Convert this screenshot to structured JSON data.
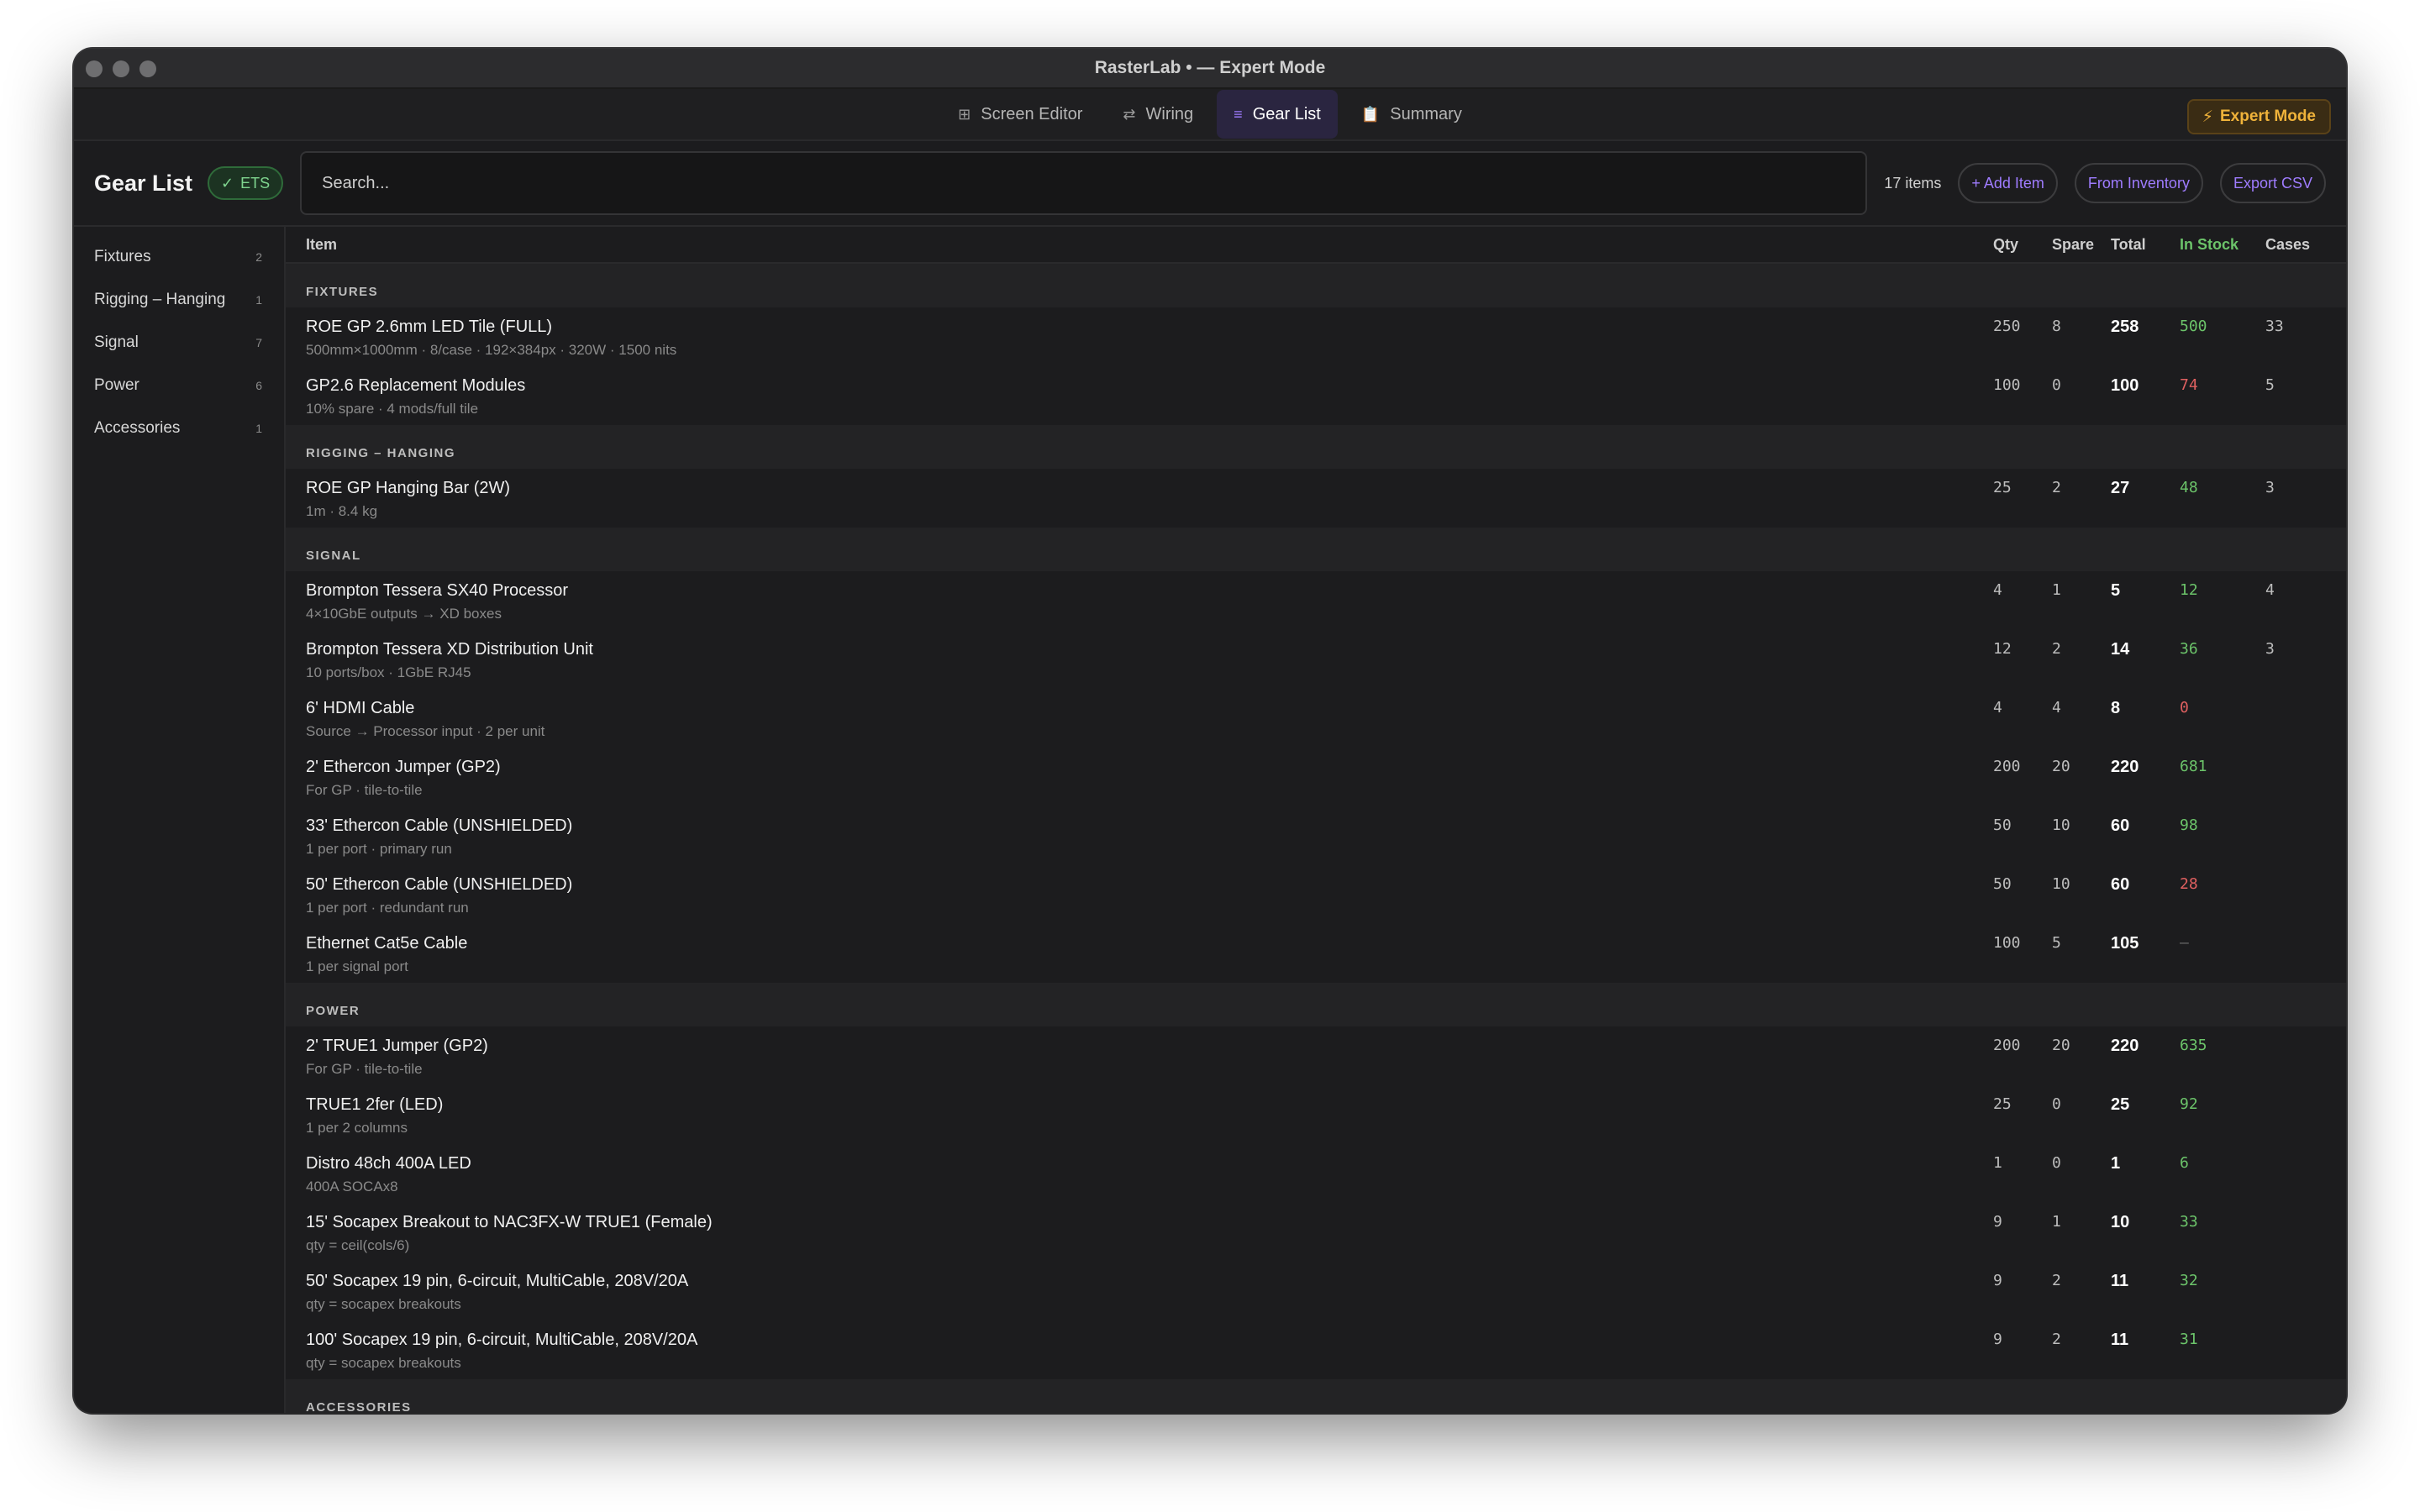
{
  "window": {
    "title": "RasterLab • — Expert Mode"
  },
  "tabs": [
    {
      "icon": "⊞",
      "label": "Screen Editor",
      "active": false
    },
    {
      "icon": "⇄",
      "label": "Wiring",
      "active": false
    },
    {
      "icon": "≡",
      "label": "Gear List",
      "active": true
    },
    {
      "icon": "📋",
      "label": "Summary",
      "active": false
    }
  ],
  "expert_button": {
    "icon": "⚡",
    "label": "Expert Mode"
  },
  "toolbar": {
    "title": "Gear List",
    "badge": {
      "icon": "✓",
      "label": "ETS"
    },
    "search_placeholder": "Search...",
    "item_count": "17 items",
    "add_item": "+ Add Item",
    "from_inventory": "From Inventory",
    "export_csv": "Export CSV"
  },
  "sidebar": [
    {
      "label": "Fixtures",
      "count": "2"
    },
    {
      "label": "Rigging – Hanging",
      "count": "1"
    },
    {
      "label": "Signal",
      "count": "7"
    },
    {
      "label": "Power",
      "count": "6"
    },
    {
      "label": "Accessories",
      "count": "1"
    }
  ],
  "table": {
    "headers": {
      "item": "Item",
      "qty": "Qty",
      "spare": "Spare",
      "total": "Total",
      "stock": "In Stock",
      "cases": "Cases"
    },
    "sections": [
      {
        "title": "FIXTURES",
        "rows": [
          {
            "name": "ROE GP 2.6mm LED Tile (FULL)",
            "desc": "500mm×1000mm · 8/case · 192×384px · 320W · 1500 nits",
            "qty": "250",
            "spare": "8",
            "total": "258",
            "stock": "500",
            "stock_status": "ok",
            "cases": "33"
          },
          {
            "name": "GP2.6 Replacement Modules",
            "desc": "10% spare · 4 mods/full tile",
            "qty": "100",
            "spare": "0",
            "total": "100",
            "stock": "74",
            "stock_status": "low",
            "cases": "5"
          }
        ]
      },
      {
        "title": "RIGGING – HANGING",
        "rows": [
          {
            "name": "ROE GP Hanging Bar (2W)",
            "desc": "1m · 8.4 kg",
            "qty": "25",
            "spare": "2",
            "total": "27",
            "stock": "48",
            "stock_status": "ok",
            "cases": "3"
          }
        ]
      },
      {
        "title": "SIGNAL",
        "rows": [
          {
            "name": "Brompton Tessera SX40 Processor",
            "desc": "4×10GbE outputs → XD boxes",
            "qty": "4",
            "spare": "1",
            "total": "5",
            "stock": "12",
            "stock_status": "ok",
            "cases": "4"
          },
          {
            "name": "Brompton Tessera XD Distribution Unit",
            "desc": "10 ports/box · 1GbE RJ45",
            "qty": "12",
            "spare": "2",
            "total": "14",
            "stock": "36",
            "stock_status": "ok",
            "cases": "3"
          },
          {
            "name": "6' HDMI Cable",
            "desc": "Source → Processor input · 2 per unit",
            "qty": "4",
            "spare": "4",
            "total": "8",
            "stock": "0",
            "stock_status": "low",
            "cases": ""
          },
          {
            "name": "2' Ethercon Jumper (GP2)",
            "desc": "For GP · tile-to-tile",
            "qty": "200",
            "spare": "20",
            "total": "220",
            "stock": "681",
            "stock_status": "ok",
            "cases": ""
          },
          {
            "name": "33' Ethercon Cable (UNSHIELDED)",
            "desc": "1 per port · primary run",
            "qty": "50",
            "spare": "10",
            "total": "60",
            "stock": "98",
            "stock_status": "ok",
            "cases": ""
          },
          {
            "name": "50' Ethercon Cable (UNSHIELDED)",
            "desc": "1 per port · redundant run",
            "qty": "50",
            "spare": "10",
            "total": "60",
            "stock": "28",
            "stock_status": "low",
            "cases": ""
          },
          {
            "name": "Ethernet Cat5e Cable",
            "desc": "1 per signal port",
            "qty": "100",
            "spare": "5",
            "total": "105",
            "stock": "—",
            "stock_status": "none",
            "cases": ""
          }
        ]
      },
      {
        "title": "POWER",
        "rows": [
          {
            "name": "2' TRUE1 Jumper (GP2)",
            "desc": "For GP · tile-to-tile",
            "qty": "200",
            "spare": "20",
            "total": "220",
            "stock": "635",
            "stock_status": "ok",
            "cases": ""
          },
          {
            "name": "TRUE1 2fer (LED)",
            "desc": "1 per 2 columns",
            "qty": "25",
            "spare": "0",
            "total": "25",
            "stock": "92",
            "stock_status": "ok",
            "cases": ""
          },
          {
            "name": "Distro 48ch 400A LED",
            "desc": "400A SOCAx8",
            "qty": "1",
            "spare": "0",
            "total": "1",
            "stock": "6",
            "stock_status": "ok",
            "cases": ""
          },
          {
            "name": "15' Socapex Breakout to NAC3FX-W TRUE1 (Female)",
            "desc": "qty = ceil(cols/6)",
            "qty": "9",
            "spare": "1",
            "total": "10",
            "stock": "33",
            "stock_status": "ok",
            "cases": ""
          },
          {
            "name": "50' Socapex 19 pin, 6-circuit, MultiCable, 208V/20A",
            "desc": "qty = socapex breakouts",
            "qty": "9",
            "spare": "2",
            "total": "11",
            "stock": "32",
            "stock_status": "ok",
            "cases": ""
          },
          {
            "name": "100' Socapex 19 pin, 6-circuit, MultiCable, 208V/20A",
            "desc": "qty = socapex breakouts",
            "qty": "9",
            "spare": "2",
            "total": "11",
            "stock": "31",
            "stock_status": "ok",
            "cases": ""
          }
        ]
      },
      {
        "title": "ACCESSORIES",
        "rows": []
      }
    ]
  }
}
